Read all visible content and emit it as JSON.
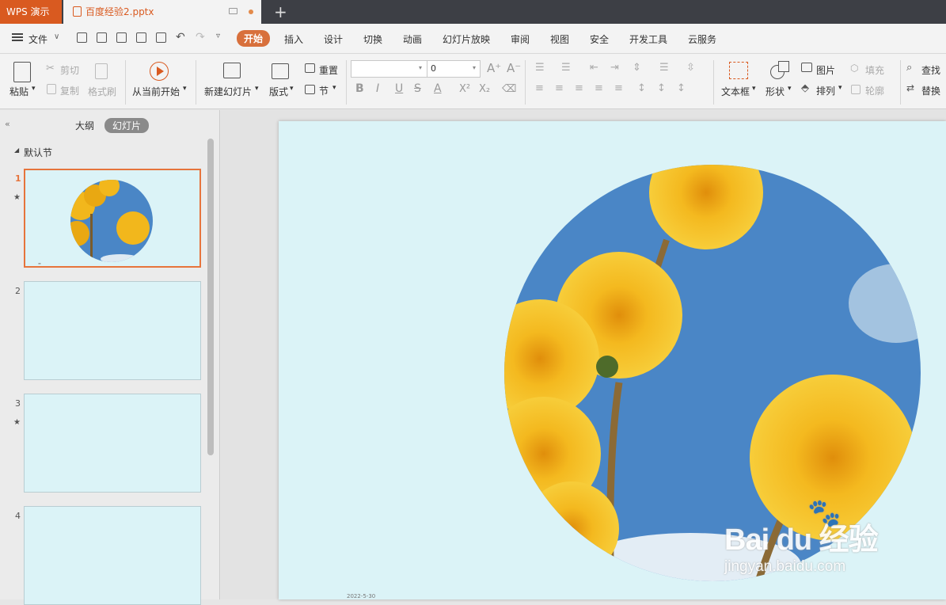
{
  "titlebar": {
    "app_name": "WPS 演示",
    "doc_tab": "百度经验2.pptx",
    "new_tab": "+"
  },
  "menu": {
    "file": "文件",
    "tabs": [
      "开始",
      "插入",
      "设计",
      "切换",
      "动画",
      "幻灯片放映",
      "审阅",
      "视图",
      "安全",
      "开发工具",
      "云服务"
    ],
    "active": "开始"
  },
  "toolbar": {
    "paste": "粘贴",
    "cut": "剪切",
    "copy": "复制",
    "format_painter": "格式刷",
    "from_current": "从当前开始",
    "new_slide": "新建幻灯片",
    "layout": "版式",
    "reset": "重置",
    "section": "节",
    "font_name": "",
    "font_size": "0",
    "textbox": "文本框",
    "shape": "形状",
    "picture": "图片",
    "arrange": "排列",
    "fill": "填充",
    "outline": "轮廓",
    "find": "查找",
    "replace": "替换"
  },
  "panel": {
    "outline_tab": "大纲",
    "slides_tab": "幻灯片",
    "section": "默认节",
    "slides": [
      "1",
      "2",
      "3",
      "4"
    ]
  },
  "slide": {
    "date": "2022-5-30",
    "watermark_brand": "Bai du 经验",
    "watermark_url": "jingyan.baidu.com"
  },
  "colors": {
    "accent": "#d95a20",
    "slide_bg": "#dbf3f7",
    "sky": "#4a86c6",
    "petal": "#f2b71c"
  }
}
